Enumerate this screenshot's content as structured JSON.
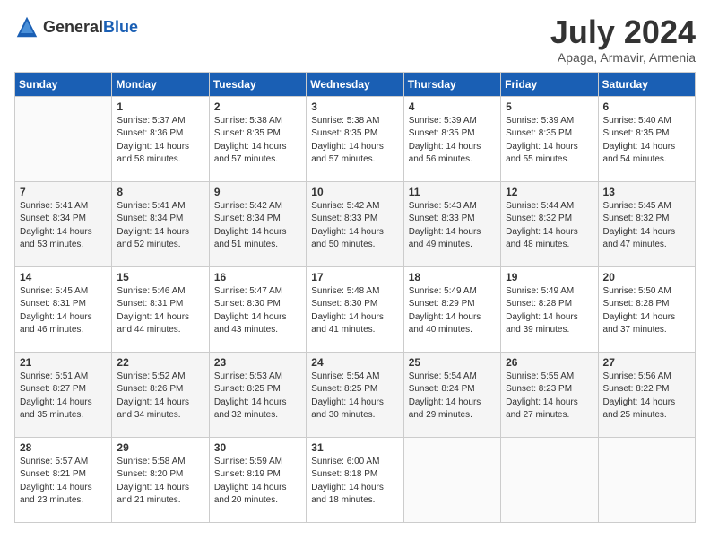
{
  "header": {
    "logo_general": "General",
    "logo_blue": "Blue",
    "month": "July 2024",
    "location": "Apaga, Armavir, Armenia"
  },
  "weekdays": [
    "Sunday",
    "Monday",
    "Tuesday",
    "Wednesday",
    "Thursday",
    "Friday",
    "Saturday"
  ],
  "weeks": [
    [
      {
        "day": "",
        "sunrise": "",
        "sunset": "",
        "daylight": ""
      },
      {
        "day": "1",
        "sunrise": "Sunrise: 5:37 AM",
        "sunset": "Sunset: 8:36 PM",
        "daylight": "Daylight: 14 hours and 58 minutes."
      },
      {
        "day": "2",
        "sunrise": "Sunrise: 5:38 AM",
        "sunset": "Sunset: 8:35 PM",
        "daylight": "Daylight: 14 hours and 57 minutes."
      },
      {
        "day": "3",
        "sunrise": "Sunrise: 5:38 AM",
        "sunset": "Sunset: 8:35 PM",
        "daylight": "Daylight: 14 hours and 57 minutes."
      },
      {
        "day": "4",
        "sunrise": "Sunrise: 5:39 AM",
        "sunset": "Sunset: 8:35 PM",
        "daylight": "Daylight: 14 hours and 56 minutes."
      },
      {
        "day": "5",
        "sunrise": "Sunrise: 5:39 AM",
        "sunset": "Sunset: 8:35 PM",
        "daylight": "Daylight: 14 hours and 55 minutes."
      },
      {
        "day": "6",
        "sunrise": "Sunrise: 5:40 AM",
        "sunset": "Sunset: 8:35 PM",
        "daylight": "Daylight: 14 hours and 54 minutes."
      }
    ],
    [
      {
        "day": "7",
        "sunrise": "Sunrise: 5:41 AM",
        "sunset": "Sunset: 8:34 PM",
        "daylight": "Daylight: 14 hours and 53 minutes."
      },
      {
        "day": "8",
        "sunrise": "Sunrise: 5:41 AM",
        "sunset": "Sunset: 8:34 PM",
        "daylight": "Daylight: 14 hours and 52 minutes."
      },
      {
        "day": "9",
        "sunrise": "Sunrise: 5:42 AM",
        "sunset": "Sunset: 8:34 PM",
        "daylight": "Daylight: 14 hours and 51 minutes."
      },
      {
        "day": "10",
        "sunrise": "Sunrise: 5:42 AM",
        "sunset": "Sunset: 8:33 PM",
        "daylight": "Daylight: 14 hours and 50 minutes."
      },
      {
        "day": "11",
        "sunrise": "Sunrise: 5:43 AM",
        "sunset": "Sunset: 8:33 PM",
        "daylight": "Daylight: 14 hours and 49 minutes."
      },
      {
        "day": "12",
        "sunrise": "Sunrise: 5:44 AM",
        "sunset": "Sunset: 8:32 PM",
        "daylight": "Daylight: 14 hours and 48 minutes."
      },
      {
        "day": "13",
        "sunrise": "Sunrise: 5:45 AM",
        "sunset": "Sunset: 8:32 PM",
        "daylight": "Daylight: 14 hours and 47 minutes."
      }
    ],
    [
      {
        "day": "14",
        "sunrise": "Sunrise: 5:45 AM",
        "sunset": "Sunset: 8:31 PM",
        "daylight": "Daylight: 14 hours and 46 minutes."
      },
      {
        "day": "15",
        "sunrise": "Sunrise: 5:46 AM",
        "sunset": "Sunset: 8:31 PM",
        "daylight": "Daylight: 14 hours and 44 minutes."
      },
      {
        "day": "16",
        "sunrise": "Sunrise: 5:47 AM",
        "sunset": "Sunset: 8:30 PM",
        "daylight": "Daylight: 14 hours and 43 minutes."
      },
      {
        "day": "17",
        "sunrise": "Sunrise: 5:48 AM",
        "sunset": "Sunset: 8:30 PM",
        "daylight": "Daylight: 14 hours and 41 minutes."
      },
      {
        "day": "18",
        "sunrise": "Sunrise: 5:49 AM",
        "sunset": "Sunset: 8:29 PM",
        "daylight": "Daylight: 14 hours and 40 minutes."
      },
      {
        "day": "19",
        "sunrise": "Sunrise: 5:49 AM",
        "sunset": "Sunset: 8:28 PM",
        "daylight": "Daylight: 14 hours and 39 minutes."
      },
      {
        "day": "20",
        "sunrise": "Sunrise: 5:50 AM",
        "sunset": "Sunset: 8:28 PM",
        "daylight": "Daylight: 14 hours and 37 minutes."
      }
    ],
    [
      {
        "day": "21",
        "sunrise": "Sunrise: 5:51 AM",
        "sunset": "Sunset: 8:27 PM",
        "daylight": "Daylight: 14 hours and 35 minutes."
      },
      {
        "day": "22",
        "sunrise": "Sunrise: 5:52 AM",
        "sunset": "Sunset: 8:26 PM",
        "daylight": "Daylight: 14 hours and 34 minutes."
      },
      {
        "day": "23",
        "sunrise": "Sunrise: 5:53 AM",
        "sunset": "Sunset: 8:25 PM",
        "daylight": "Daylight: 14 hours and 32 minutes."
      },
      {
        "day": "24",
        "sunrise": "Sunrise: 5:54 AM",
        "sunset": "Sunset: 8:25 PM",
        "daylight": "Daylight: 14 hours and 30 minutes."
      },
      {
        "day": "25",
        "sunrise": "Sunrise: 5:54 AM",
        "sunset": "Sunset: 8:24 PM",
        "daylight": "Daylight: 14 hours and 29 minutes."
      },
      {
        "day": "26",
        "sunrise": "Sunrise: 5:55 AM",
        "sunset": "Sunset: 8:23 PM",
        "daylight": "Daylight: 14 hours and 27 minutes."
      },
      {
        "day": "27",
        "sunrise": "Sunrise: 5:56 AM",
        "sunset": "Sunset: 8:22 PM",
        "daylight": "Daylight: 14 hours and 25 minutes."
      }
    ],
    [
      {
        "day": "28",
        "sunrise": "Sunrise: 5:57 AM",
        "sunset": "Sunset: 8:21 PM",
        "daylight": "Daylight: 14 hours and 23 minutes."
      },
      {
        "day": "29",
        "sunrise": "Sunrise: 5:58 AM",
        "sunset": "Sunset: 8:20 PM",
        "daylight": "Daylight: 14 hours and 21 minutes."
      },
      {
        "day": "30",
        "sunrise": "Sunrise: 5:59 AM",
        "sunset": "Sunset: 8:19 PM",
        "daylight": "Daylight: 14 hours and 20 minutes."
      },
      {
        "day": "31",
        "sunrise": "Sunrise: 6:00 AM",
        "sunset": "Sunset: 8:18 PM",
        "daylight": "Daylight: 14 hours and 18 minutes."
      },
      {
        "day": "",
        "sunrise": "",
        "sunset": "",
        "daylight": ""
      },
      {
        "day": "",
        "sunrise": "",
        "sunset": "",
        "daylight": ""
      },
      {
        "day": "",
        "sunrise": "",
        "sunset": "",
        "daylight": ""
      }
    ]
  ]
}
